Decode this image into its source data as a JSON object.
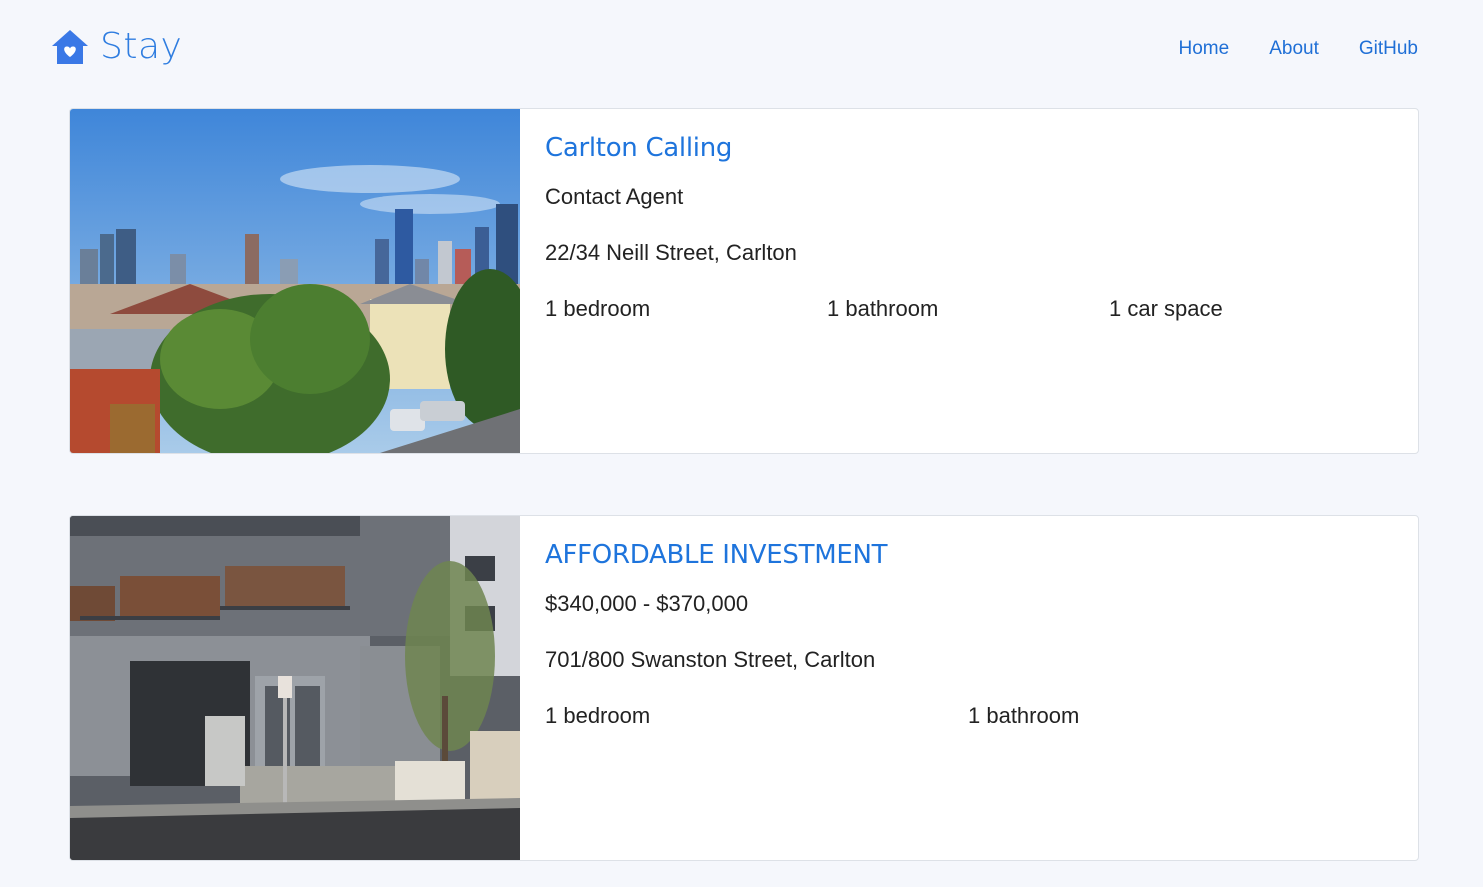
{
  "brand": {
    "name": "Stay",
    "icon": "house-heart-icon",
    "color": "#2f7de0"
  },
  "nav": {
    "home": "Home",
    "about": "About",
    "github": "GitHub"
  },
  "listings": [
    {
      "title": "Carlton Calling",
      "price": "Contact Agent",
      "address": "22/34 Neill Street, Carlton",
      "bedrooms": "1 bedroom",
      "bathrooms": "1 bathroom",
      "parking": "1 car space"
    },
    {
      "title": "AFFORDABLE INVESTMENT",
      "price": "$340,000 - $370,000",
      "address": "701/800 Swanston Street, Carlton",
      "bedrooms": "1 bedroom",
      "bathrooms": "1 bathroom"
    }
  ],
  "colors": {
    "accent": "#1e74dc",
    "background": "#f5f7fc"
  }
}
